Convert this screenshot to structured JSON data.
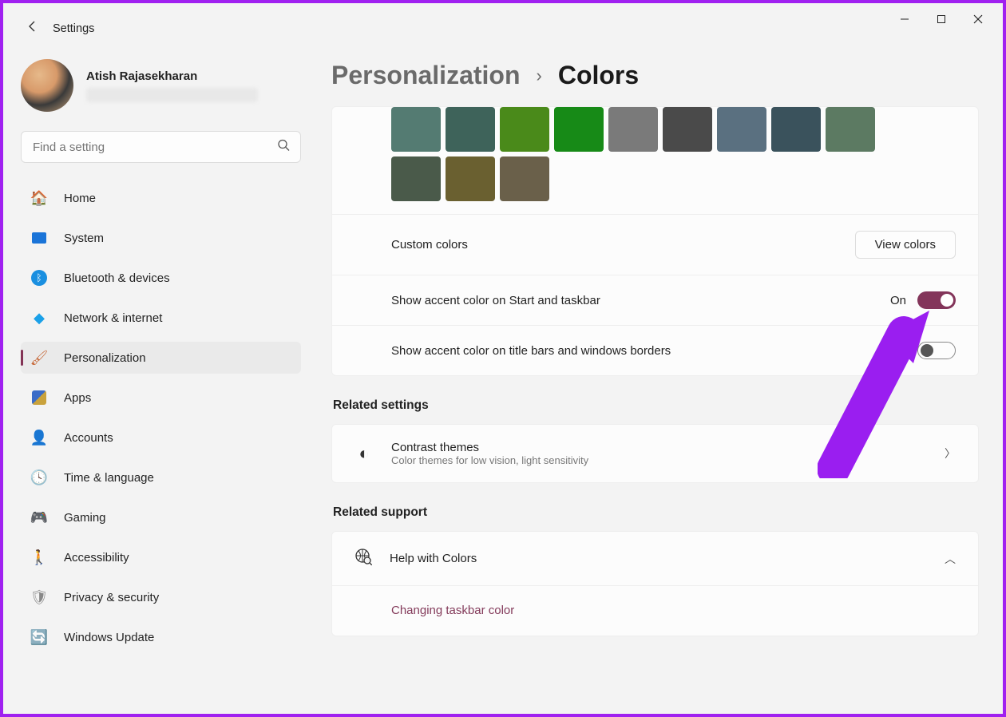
{
  "app": {
    "title": "Settings"
  },
  "profile": {
    "name": "Atish Rajasekharan"
  },
  "search": {
    "placeholder": "Find a setting"
  },
  "nav": {
    "items": [
      {
        "label": "Home",
        "icon": "home-icon"
      },
      {
        "label": "System",
        "icon": "system-icon"
      },
      {
        "label": "Bluetooth & devices",
        "icon": "bluetooth-icon"
      },
      {
        "label": "Network & internet",
        "icon": "network-icon"
      },
      {
        "label": "Personalization",
        "icon": "personalization-icon",
        "active": true
      },
      {
        "label": "Apps",
        "icon": "apps-icon"
      },
      {
        "label": "Accounts",
        "icon": "accounts-icon"
      },
      {
        "label": "Time & language",
        "icon": "time-language-icon"
      },
      {
        "label": "Gaming",
        "icon": "gaming-icon"
      },
      {
        "label": "Accessibility",
        "icon": "accessibility-icon"
      },
      {
        "label": "Privacy & security",
        "icon": "privacy-icon"
      },
      {
        "label": "Windows Update",
        "icon": "update-icon"
      }
    ]
  },
  "breadcrumb": {
    "parent": "Personalization",
    "current": "Colors"
  },
  "colors": {
    "swatch_rows": [
      [
        "#547b72",
        "#3e635a",
        "#4a8a1a",
        "#178a17",
        "#7a7a7a",
        "#4a4a4a",
        "#5a7080",
        "#3a525c",
        "#5c7a62"
      ],
      [
        "#4a5a4a",
        "#6a6030",
        "#6a604a"
      ]
    ],
    "custom_label": "Custom colors",
    "view_button": "View colors",
    "accent_start": {
      "label": "Show accent color on Start and taskbar",
      "state": "On",
      "on": true
    },
    "accent_title": {
      "label": "Show accent color on title bars and windows borders",
      "on": false
    }
  },
  "related": {
    "heading": "Related settings",
    "contrast": {
      "title": "Contrast themes",
      "desc": "Color themes for low vision, light sensitivity"
    }
  },
  "support": {
    "heading": "Related support",
    "help_title": "Help with Colors",
    "item1": "Changing taskbar color"
  },
  "accent_color": "#83355a",
  "annotation_color": "#9a1ef0"
}
